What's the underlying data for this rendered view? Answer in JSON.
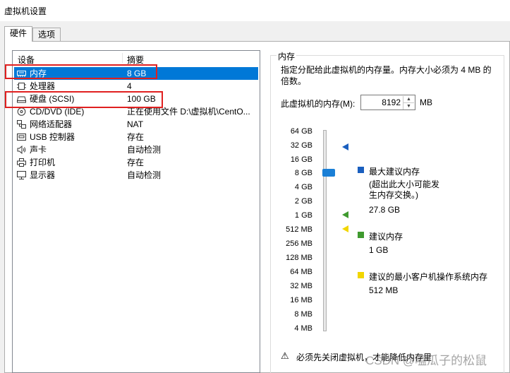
{
  "window": {
    "title": "虚拟机设置"
  },
  "tabs": [
    {
      "label": "硬件"
    },
    {
      "label": "选项"
    }
  ],
  "device_list": {
    "headers": {
      "device": "设备",
      "summary": "摘要"
    },
    "rows": [
      {
        "name": "内存",
        "summary": "8 GB",
        "icon": "memory-icon",
        "selected": true
      },
      {
        "name": "处理器",
        "summary": "4",
        "icon": "cpu-icon"
      },
      {
        "name": "硬盘 (SCSI)",
        "summary": "100 GB",
        "icon": "hard-disk-icon"
      },
      {
        "name": "CD/DVD (IDE)",
        "summary": "正在使用文件 D:\\虚拟机\\CentO...",
        "icon": "cd-dvd-icon"
      },
      {
        "name": "网络适配器",
        "summary": "NAT",
        "icon": "network-adapter-icon"
      },
      {
        "name": "USB 控制器",
        "summary": "存在",
        "icon": "usb-icon"
      },
      {
        "name": "声卡",
        "summary": "自动检测",
        "icon": "speaker-icon"
      },
      {
        "name": "打印机",
        "summary": "存在",
        "icon": "printer-icon"
      },
      {
        "name": "显示器",
        "summary": "自动检测",
        "icon": "monitor-icon"
      }
    ]
  },
  "memory": {
    "group_title": "内存",
    "description": "指定分配给此虚拟机的内存量。内存大小必须为 4 MB 的倍数。",
    "field_label": "此虚拟机的内存(M):",
    "field_value": "8192",
    "unit": "MB",
    "scale_ticks": [
      "64 GB",
      "32 GB",
      "16 GB",
      "8 GB",
      "4 GB",
      "2 GB",
      "1 GB",
      "512 MB",
      "256 MB",
      "128 MB",
      "64 MB",
      "32 MB",
      "16 MB",
      "8 MB",
      "4 MB"
    ],
    "slider_value": "8 GB",
    "legend": {
      "max": {
        "title": "最大建议内存",
        "note": "(超出此大小可能发生内存交换。)",
        "value": "27.8 GB",
        "color": "#1a5fbf"
      },
      "recommended": {
        "title": "建议内存",
        "value": "1 GB",
        "color": "#3f9a2f"
      },
      "min": {
        "title": "建议的最小客户机操作系统内存",
        "value": "512 MB",
        "color": "#f2d600"
      }
    },
    "warning": "必须先关闭虚拟机，才能降低内存里"
  },
  "watermark": "CSDN @嗑瓜子的松鼠"
}
